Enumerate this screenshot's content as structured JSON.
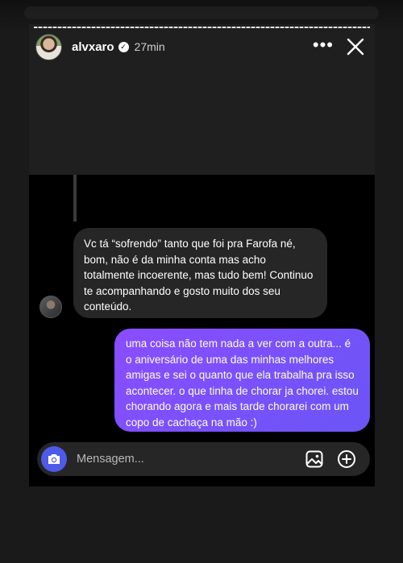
{
  "header": {
    "username": "alvxaro",
    "time_ago": "27min",
    "more_label": "•••"
  },
  "progress": {
    "fraction": 1.0
  },
  "messages": {
    "incoming": "Vc tá “sofrendo” tanto que foi pra Farofa né, bom, não é da minha conta mas acho totalmente incoerente, mas tudo bem! Continuo te acompanhando e gosto muito dos seu conteúdo.",
    "outgoing": "uma coisa não tem nada a ver com a outra... é o aniversário de uma das minhas melhores amigas e sei o quanto que ela trabalha pra isso acontecer. o que tinha de chorar ja chorei. estou chorando agora e mais tarde chorarei com um copo de cachaça na mão :)"
  },
  "composer": {
    "placeholder": "Mensagem..."
  },
  "icons": {
    "verified": "verified-badge-icon",
    "more": "more-options-icon",
    "close": "close-icon",
    "camera": "camera-icon",
    "image": "image-icon",
    "add": "add-icon"
  },
  "colors": {
    "outgoing_bubble_start": "#8a4dff",
    "outgoing_bubble_end": "#6a55f6",
    "camera_button": "#4e5ae8",
    "incoming_bubble": "#262626"
  }
}
